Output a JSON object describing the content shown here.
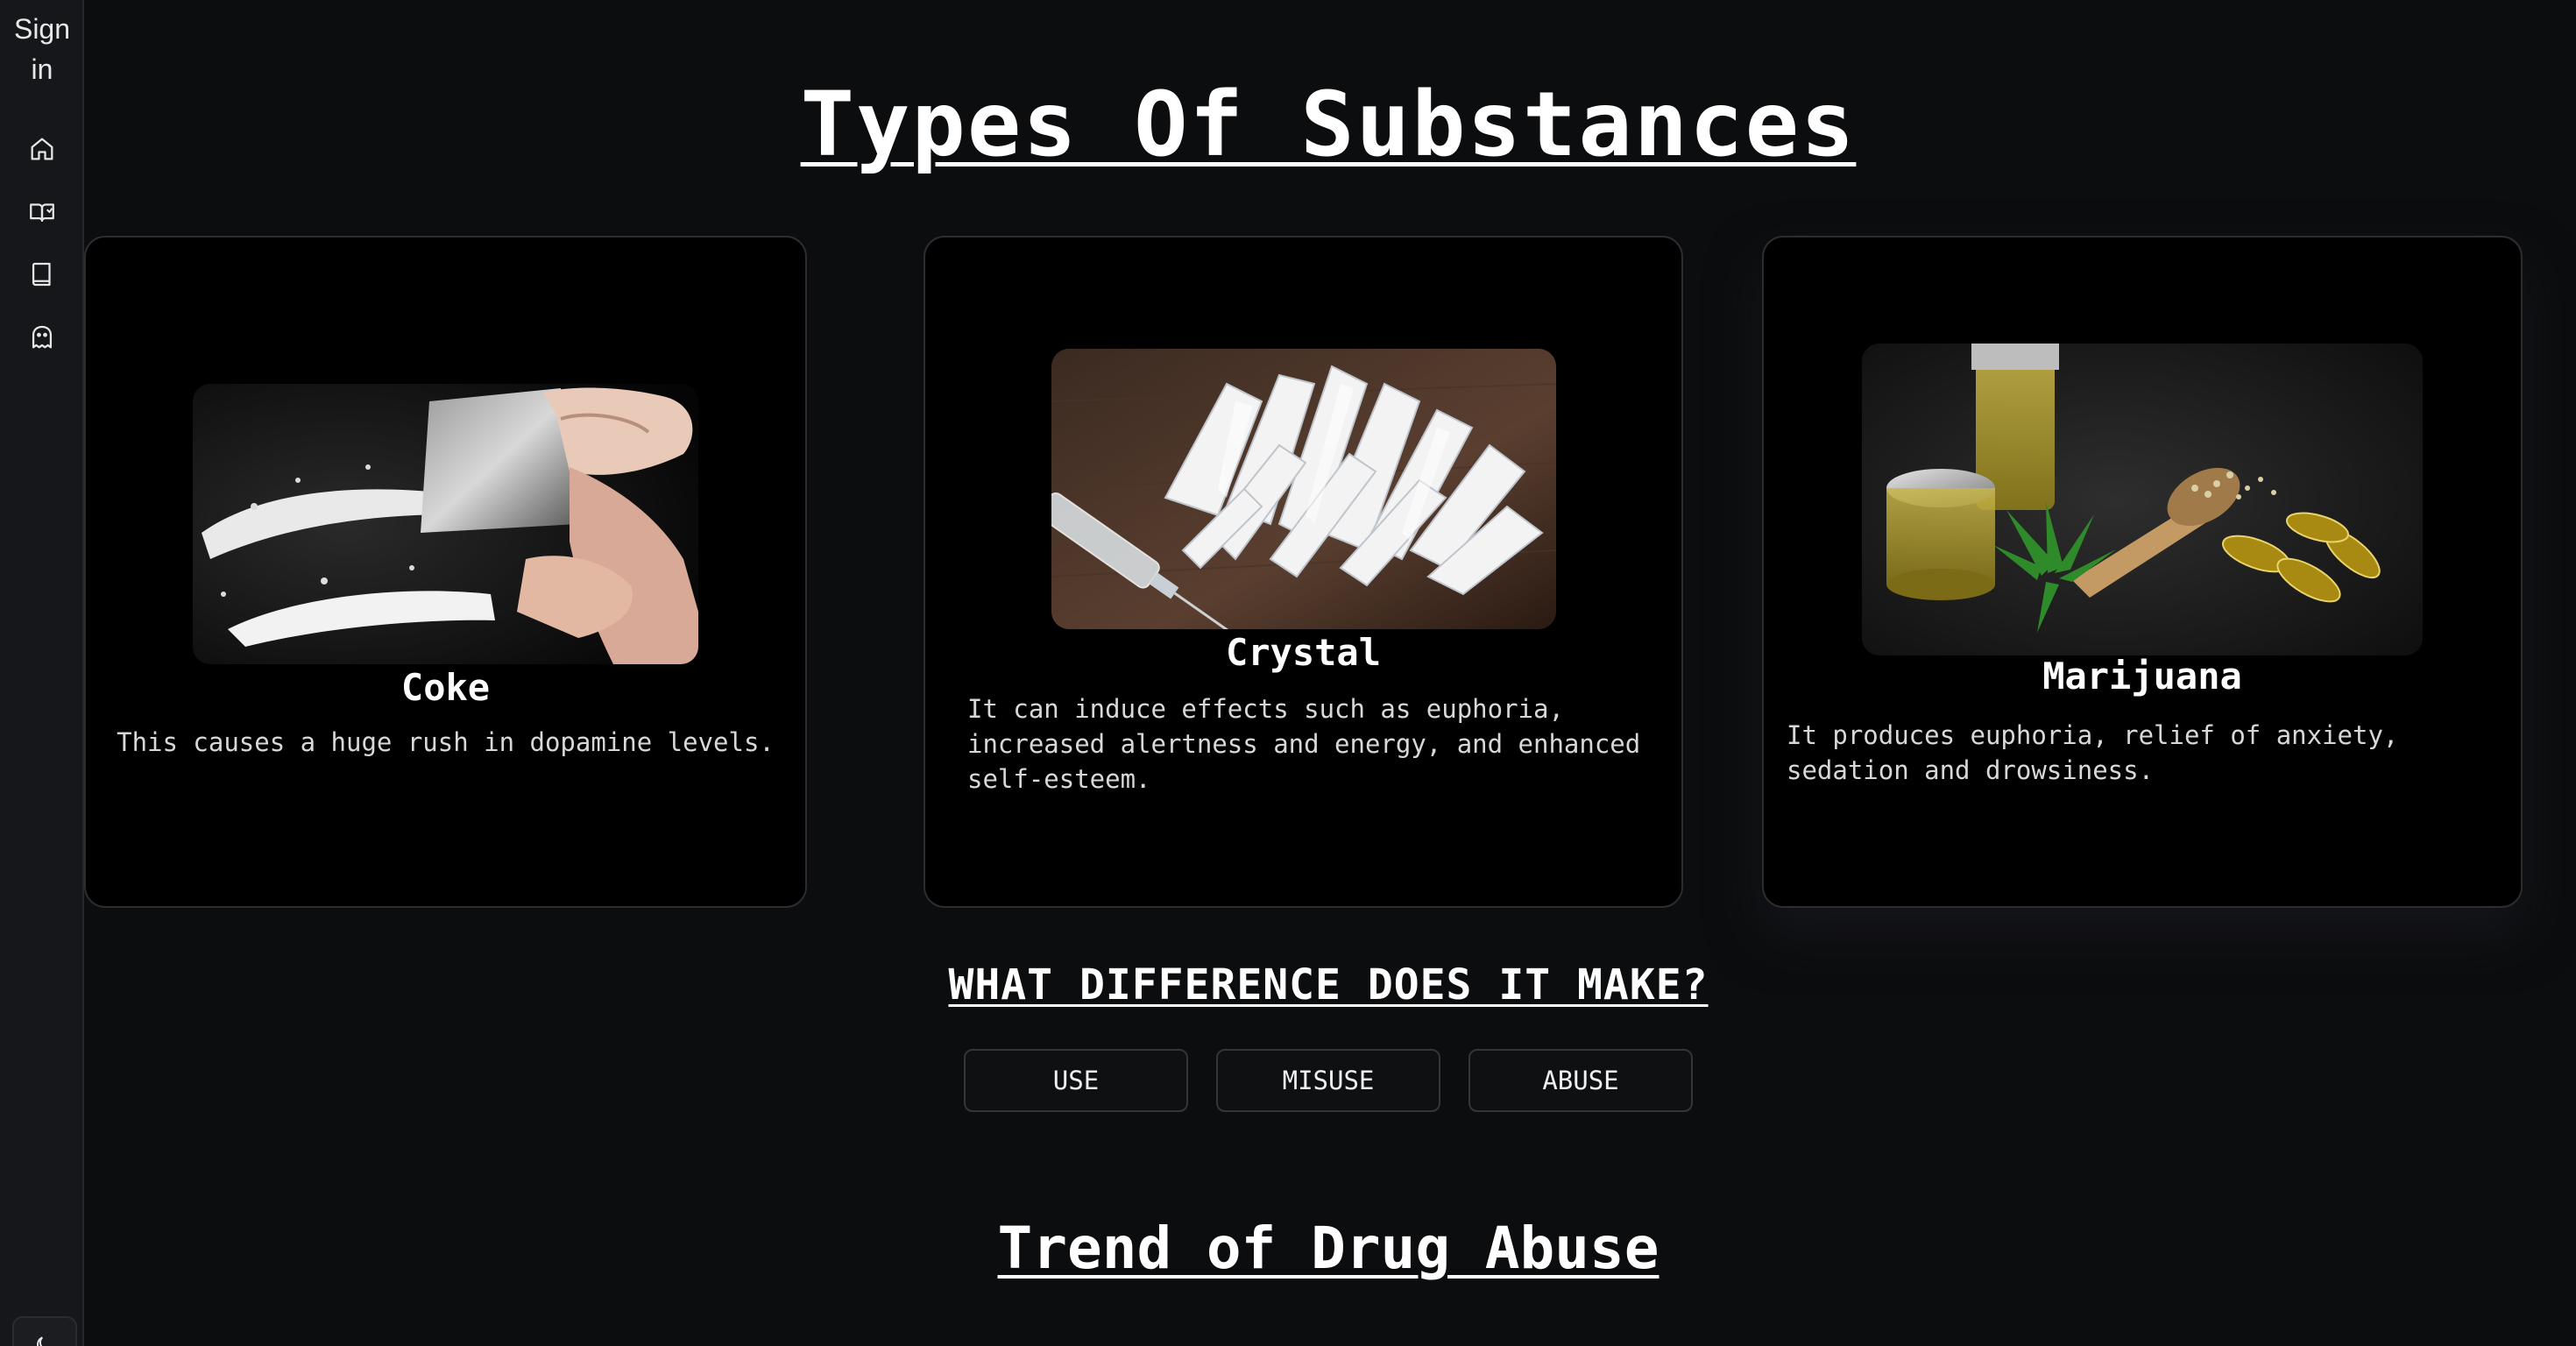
{
  "sidebar": {
    "signin_label": "Sign in",
    "icons": [
      "home-icon",
      "book-open-icon",
      "book-icon",
      "ghost-icon"
    ],
    "theme_toggle_icon": "moon-icon"
  },
  "main": {
    "title": "Types Of Substances"
  },
  "cards": [
    {
      "name": "Coke",
      "description": "This causes a huge rush in dopamine levels.",
      "image": "white powder lines with a razor blade"
    },
    {
      "name": "Crystal",
      "description": "It can induce effects such as euphoria, increased alertness and energy, and enhanced self-esteem.",
      "image": "clear crystal shards with a syringe"
    },
    {
      "name": "Marijuana",
      "description": "It produces euphoria, relief of anxiety, sedation and drowsiness.",
      "image": "cannabis oil jars, leaf, seeds and capsules"
    }
  ],
  "difference": {
    "title": "WHAT DIFFERENCE DOES IT MAKE?",
    "buttons": [
      "USE",
      "MISUSE",
      "ABUSE"
    ]
  },
  "trend": {
    "title": "Trend of Drug Abuse"
  },
  "colors": {
    "background": "#0c0d0f",
    "sidebar": "#16171a",
    "card": "#000000",
    "border": "#2c2d31",
    "text": "#ffffff"
  }
}
